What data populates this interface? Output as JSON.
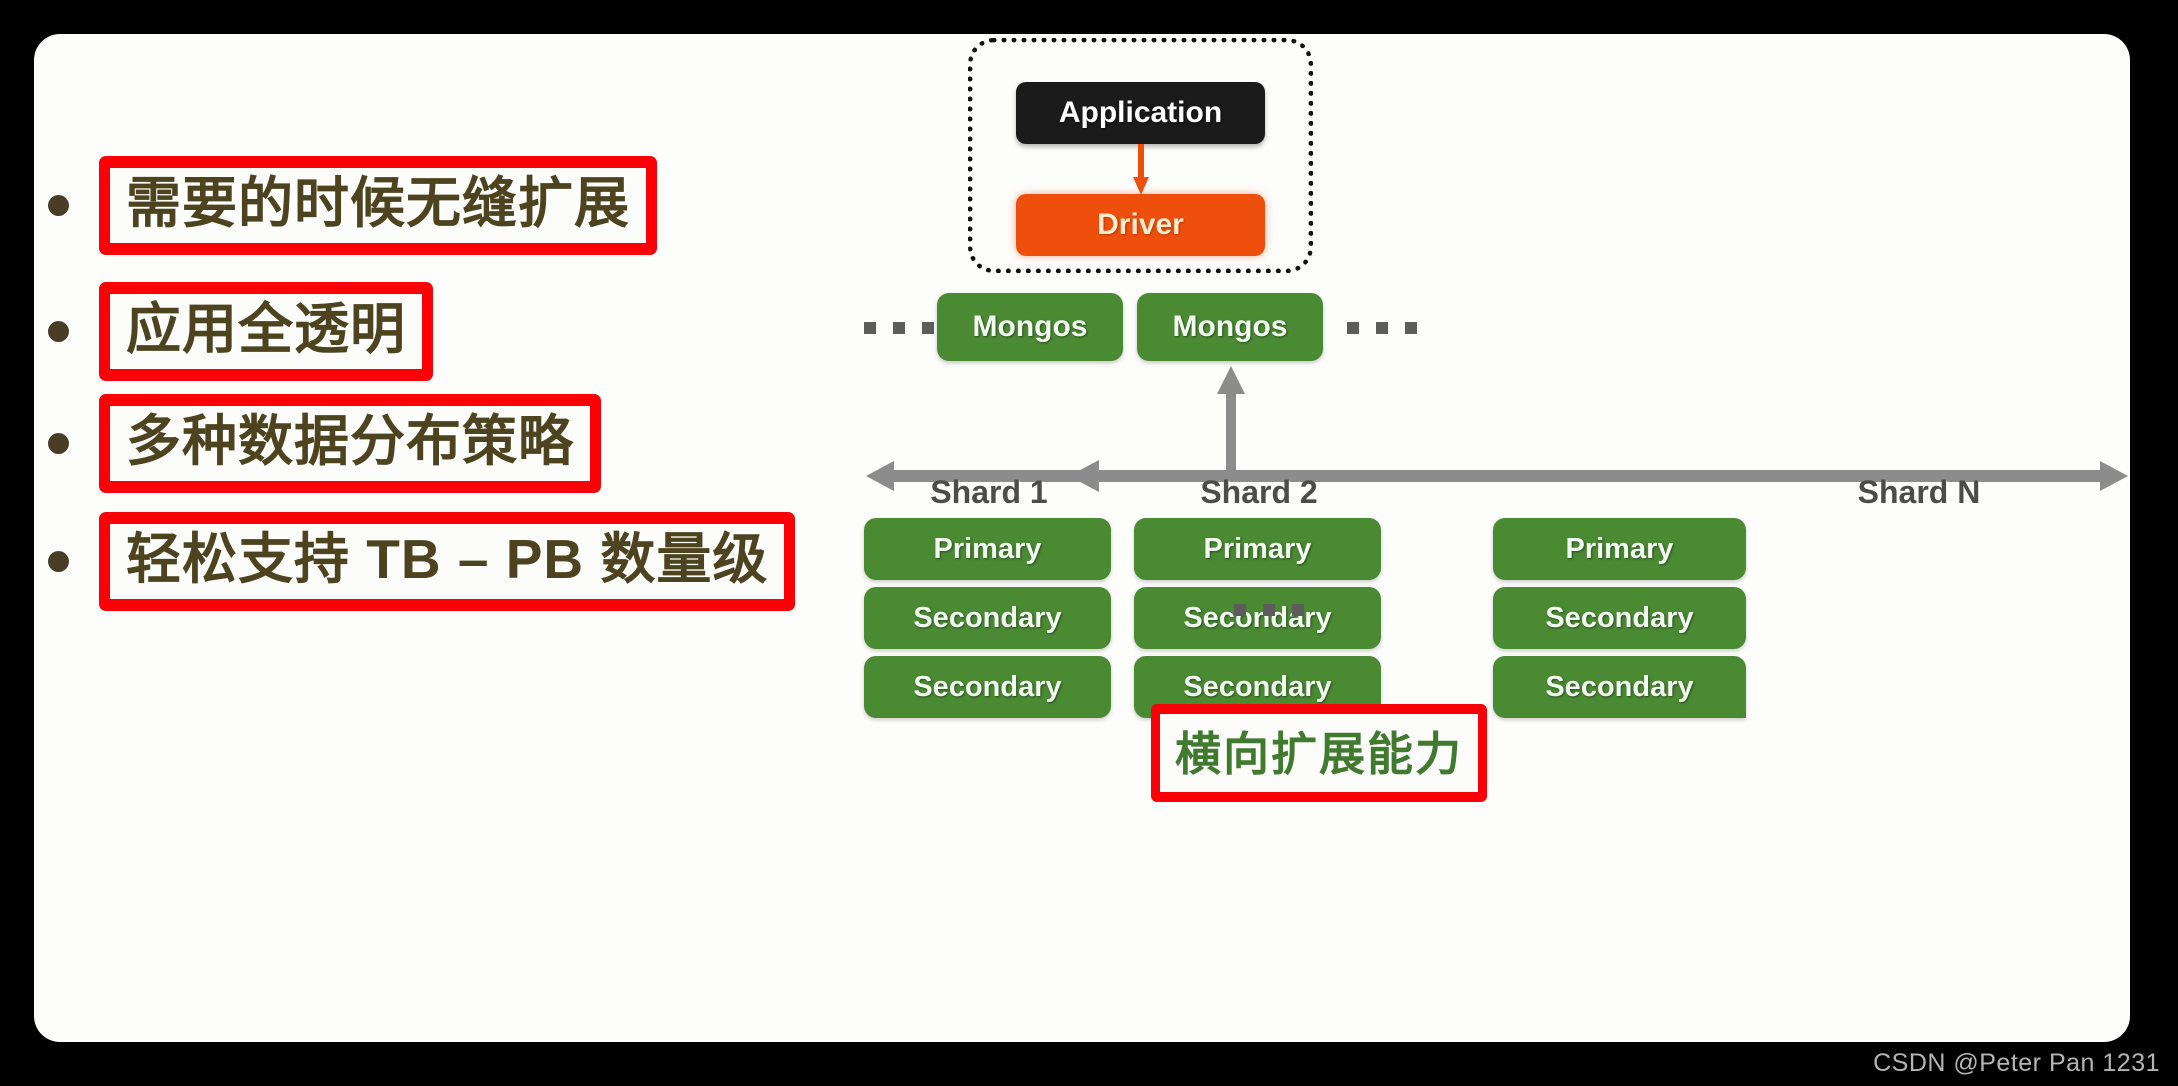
{
  "slide": {
    "background_color": "#000000",
    "card_color": "#fdfdfb"
  },
  "bullets": {
    "items": [
      {
        "text": "需要的时候无缝扩展"
      },
      {
        "text": "应用全透明"
      },
      {
        "text": "多种数据分布策略"
      },
      {
        "text": "轻松支持 TB – PB 数量级"
      }
    ],
    "highlight_color": "#fb0007",
    "text_color": "#4e431f"
  },
  "diagram": {
    "application": {
      "label": "Application",
      "color": "#1b1b1b",
      "text_color": "#ffffff"
    },
    "driver": {
      "label": "Driver",
      "color": "#ef4f0c",
      "text_color": "#fdeccd"
    },
    "mongos": [
      {
        "label": "Mongos"
      },
      {
        "label": "Mongos"
      }
    ],
    "mongos_color": "#4a8a33",
    "ellipsis_left": "...",
    "ellipsis_right": "...",
    "ellipsis_shards": "...",
    "shards": [
      {
        "label": "Shard 1",
        "nodes": [
          {
            "label": "Primary"
          },
          {
            "label": "Secondary"
          },
          {
            "label": "Secondary"
          }
        ]
      },
      {
        "label": "Shard 2",
        "nodes": [
          {
            "label": "Primary"
          },
          {
            "label": "Secondary"
          },
          {
            "label": "Secondary"
          }
        ]
      },
      {
        "label": "Shard N",
        "nodes": [
          {
            "label": "Primary"
          },
          {
            "label": "Secondary"
          },
          {
            "label": "Secondary"
          }
        ]
      }
    ],
    "shard_label_color": "#4c4c4c",
    "node_color": "#4a8a33",
    "arrow_color": "#8c8c8c"
  },
  "caption": {
    "text": "横向扩展能力",
    "text_color": "#3f7a2e",
    "border_color": "#fb0007"
  },
  "watermark": {
    "text": "CSDN @Peter Pan 1231"
  }
}
